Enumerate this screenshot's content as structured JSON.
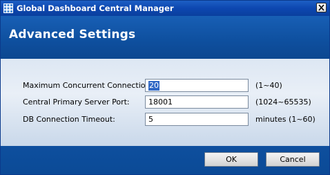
{
  "window": {
    "title": "Global Dashboard Central Manager",
    "close_icon": "close-icon",
    "app_icon": "dashboard-grid-icon"
  },
  "header": {
    "title": "Advanced Settings"
  },
  "settings": [
    {
      "label": "Maximum Concurrent Connections:",
      "value": "20",
      "hint": "(1~40)"
    },
    {
      "label": "Central Primary Server Port:",
      "value": "18001",
      "hint": "(1024~65535)"
    },
    {
      "label": "DB Connection Timeout:",
      "value": "5",
      "hint": "minutes (1~60)"
    }
  ],
  "buttons": {
    "ok": "OK",
    "cancel": "Cancel"
  },
  "colors": {
    "title_bar": "#0d47b0",
    "header": "#0e4f9e",
    "content": "#e0e9f4",
    "selection": "#3169c6"
  }
}
